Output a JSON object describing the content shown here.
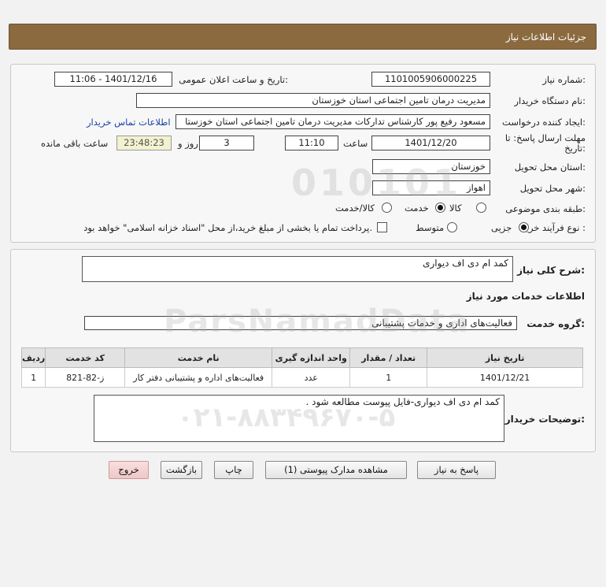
{
  "header": {
    "title": "جزئیات اطلاعات نیاز"
  },
  "fields": {
    "need_number_label": "شماره نیاز:",
    "need_number": "1101005906000225",
    "announce_label": "تاریخ و ساعت اعلان عمومی:",
    "announce_value": "1401/12/16 - 11:06",
    "buyer_org_label": "نام دستگاه خریدار:",
    "buyer_org": "مدیریت درمان تامین اجتماعی استان خوزستان",
    "requester_label": "ایجاد کننده درخواست:",
    "requester": "مسعود رفیع پور کارشناس تدارکات مدیریت درمان تامین اجتماعی استان خوزستا",
    "contact_link": "اطلاعات تماس خریدار",
    "deadline_label_1": "مهلت ارسال پاسخ: تا",
    "deadline_label_2": "تاریخ:",
    "deadline_date": "1401/12/20",
    "time_label": "ساعت",
    "deadline_time": "11:10",
    "days_value": "3",
    "days_label": "روز و",
    "remaining_time": "23:48:23",
    "remaining_label": "ساعت باقی مانده",
    "province_label": "استان محل تحویل:",
    "province": "خوزستان",
    "city_label": "شهر محل تحویل:",
    "city": "اهواز",
    "category_label": "طبقه بندی موضوعی:",
    "category_options": [
      "کالا",
      "خدمت",
      "کالا/خدمت"
    ],
    "category_selected": "خدمت",
    "process_label": "نوع فرآیند خرید :",
    "process_options": [
      "جزیی",
      "متوسط"
    ],
    "process_selected": "جزیی",
    "payment_note": "پرداخت تمام یا بخشی از مبلغ خرید،از محل \"اسناد خزانه اسلامی\" خواهد بود."
  },
  "details": {
    "summary_label": "شرح کلی نیاز:",
    "summary": "کمد ام دی اف دیواری",
    "services_title": "اطلاعات خدمات مورد نیاز",
    "service_group_label": "گروه خدمت:",
    "service_group": "فعالیت‌های اداری و خدمات پشتیبانی",
    "table": {
      "headers": [
        "ردیف",
        "کد خدمت",
        "نام خدمت",
        "واحد اندازه گیری",
        "تعداد / مقدار",
        "تاریخ نیاز"
      ],
      "rows": [
        [
          "1",
          "ز-82-821",
          "فعالیت‌های اداره و پشتیبانی دفتر کار",
          "عدد",
          "1",
          "1401/12/21"
        ]
      ]
    },
    "buyer_notes_label": "توضیحات خریدار:",
    "buyer_notes": "کمد ام دی اف دیواری-فایل پیوست مطالعه شود ."
  },
  "buttons": {
    "reply": "پاسخ به نیاز",
    "attachments": "مشاهده مدارک پیوستی (1)",
    "print": "چاپ",
    "back": "بازگشت",
    "exit": "خروج"
  },
  "colors": {
    "header_bg": "#8b6a3f",
    "link": "#1a3ea8",
    "exit_bg": "#f0c7c7"
  }
}
